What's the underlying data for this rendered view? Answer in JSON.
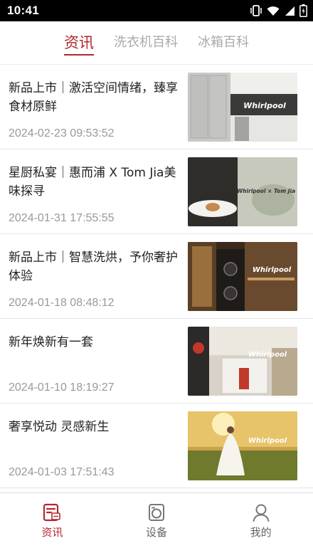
{
  "status_bar": {
    "time": "10:41"
  },
  "tabs": [
    {
      "label": "资讯",
      "active": true
    },
    {
      "label": "洗衣机百科",
      "active": false
    },
    {
      "label": "冰箱百科",
      "active": false
    }
  ],
  "news": [
    {
      "title": "新品上市｜激活空间情绪，臻享食材原鲜",
      "date": "2024-02-23 09:53:52",
      "thumb_text": "Whirlpool"
    },
    {
      "title": "星厨私宴｜惠而浦 X Tom Jia美味探寻",
      "date": "2024-01-31 17:55:55",
      "thumb_text": "Whirlpool × Tom Jia"
    },
    {
      "title": "新品上市｜智慧洗烘，予你奢护体验",
      "date": "2024-01-18 08:48:12",
      "thumb_text": "Whirlpool"
    },
    {
      "title": "新年焕新有一套",
      "date": "2024-01-10 18:19:27",
      "thumb_text": "Whirlpool"
    },
    {
      "title": "奢享悦动 灵感新生",
      "date": "2024-01-03 17:51:43",
      "thumb_text": "Whirlpool"
    }
  ],
  "bottom_nav": [
    {
      "label": "资讯",
      "icon": "news-icon",
      "active": true
    },
    {
      "label": "设备",
      "icon": "washer-icon",
      "active": false
    },
    {
      "label": "我的",
      "icon": "person-icon",
      "active": false
    }
  ],
  "colors": {
    "accent": "#b3272f",
    "inactive": "#aaaaaa",
    "date": "#999999"
  }
}
